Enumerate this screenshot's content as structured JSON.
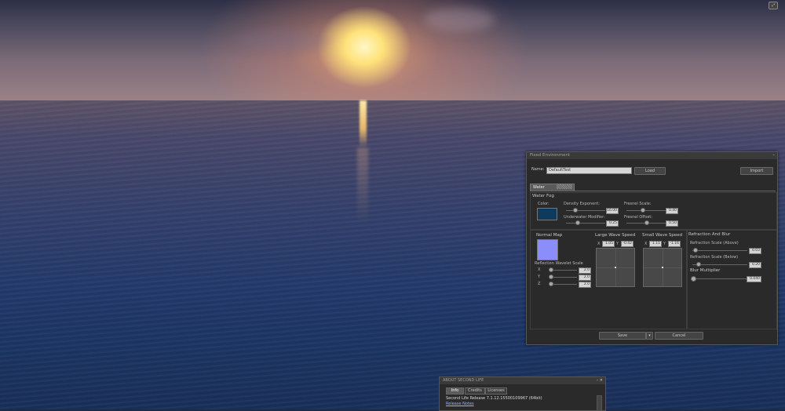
{
  "colors": {
    "panel_bg": "#2a2a2a",
    "water_fog_color": "#103a5c",
    "normal_map_color": "#8a8dfa",
    "link": "#8fb6ff"
  },
  "viewport": {
    "top_right_button": "⤢"
  },
  "panel": {
    "title": "Fixed Environment",
    "close": "–",
    "name_label": "Name:",
    "name_value": "DefaultTest",
    "load_label": "Load",
    "import_label": "Import",
    "tab_label": "Water",
    "water_fog": {
      "header": "Water Fog",
      "color_label": "Color:",
      "density_exponent_label": "Density Exponent:",
      "density_exponent_value": "16.00",
      "underwater_modifier_label": "Underwater Modifier:",
      "underwater_modifier_value": "0.25",
      "fresnel_scale_label": "Fresnel Scale:",
      "fresnel_scale_value": "0.40",
      "fresnel_offset_label": "Fresnel Offset:",
      "fresnel_offset_value": "0.50"
    },
    "normal_map": {
      "header": "Normal Map",
      "reflection_wavelet_label": "Reflection Wavelet Scale",
      "x_label": "X",
      "x_value": "2.0",
      "y_label": "Y",
      "y_value": "2.0",
      "z_label": "Z",
      "z_value": "2.0"
    },
    "large_wave": {
      "header": "Large Wave Speed",
      "x_label": "X",
      "x_value": "1.05",
      "y_label": "Y",
      "y_value": "-0.42"
    },
    "small_wave": {
      "header": "Small Wave Speed",
      "x_label": "X",
      "x_value": "1.11",
      "y_label": "Y",
      "y_value": "-1.16"
    },
    "refraction": {
      "header": "Refraction And Blur",
      "above_label": "Refraction Scale (Above)",
      "above_value": "0.03",
      "below_label": "Refraction Scale (Below)",
      "below_value": "0.20",
      "blur_label": "Blur Multiplier",
      "blur_value": "0.040"
    },
    "save_label": "Save",
    "save_dropdown": "▾",
    "cancel_label": "Cancel"
  },
  "about": {
    "title": "ABOUT SECOND LIFE",
    "controls": "– ✕",
    "tabs": [
      "Info",
      "Credits",
      "Licenses"
    ],
    "release_text": "Second Life Release 7.1.12.15500109967 (64bit)",
    "release_notes": "Release Notes"
  }
}
